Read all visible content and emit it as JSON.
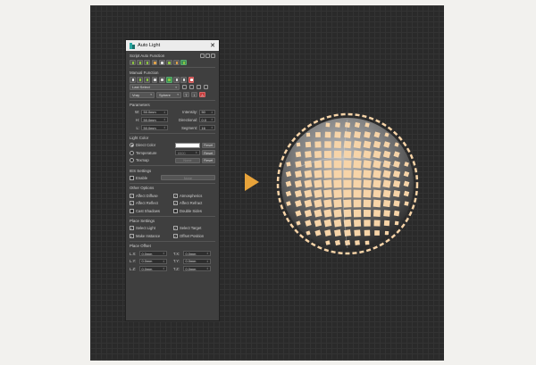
{
  "panel": {
    "title": "Auto Light",
    "sections": {
      "script_auto": "Script Auto Function",
      "manual": "Manual Function",
      "parameters": "Parameters",
      "light_color": "Light Color",
      "ies": "IES Settings",
      "other": "Other Options",
      "place": "Place Settings",
      "offset": "Place Offset"
    },
    "manual": {
      "last_select": "Last Select",
      "vray": "Vray",
      "sphere": "Sphere",
      "t": "T",
      "i": "I",
      "a": "A"
    },
    "params": {
      "w_label": "W:",
      "w_value": "50.0mm",
      "h_label": "H:",
      "h_value": "50.0mm",
      "l_label": "L:",
      "l_value": "50.0mm",
      "intensity_label": "Intensity:",
      "intensity_value": "50",
      "directional_label": "Directional:",
      "directional_value": "0.0",
      "segment_label": "Segment:",
      "segment_value": "16"
    },
    "light_color": {
      "direct_color": "Direct Color",
      "temperature": "Temperature",
      "temperature_value": "6500",
      "texmap": "Texmap",
      "none": "None",
      "reset": "Reset"
    },
    "ies": {
      "enable": "Enable",
      "none": "None"
    },
    "other": {
      "affect_diffuse": "Affect Diffuse",
      "atmospherics": "Atmospherics",
      "affect_reflect": "Affect Reflect",
      "affect_refract": "Affect Refract",
      "cast_shadows": "Cast Shadows",
      "double_sides": "Double Sides"
    },
    "place": {
      "select_light": "Select Light",
      "select_target": "Select Target",
      "make_instance": "Make Instance",
      "offset_position": "Offset Position"
    },
    "offset": {
      "lx": "L.X:",
      "lx_v": "0.0mm",
      "tx": "T.X:",
      "tx_v": "0.0mm",
      "ly": "L.Y:",
      "ly_v": "0.0mm",
      "ty": "T.Y:",
      "ty_v": "0.0mm",
      "lz": "L.Z:",
      "lz_v": "0.0mm",
      "tz": "T.Z:",
      "tz_v": "0.0mm"
    }
  },
  "colors": {
    "accent": "#e8a33a",
    "light_tile": "#f7d4a8",
    "viewport_bg": "#2a2a2a"
  },
  "icons": [
    "auto-light-logo-icon",
    "close-icon",
    "arrow-right-icon"
  ]
}
